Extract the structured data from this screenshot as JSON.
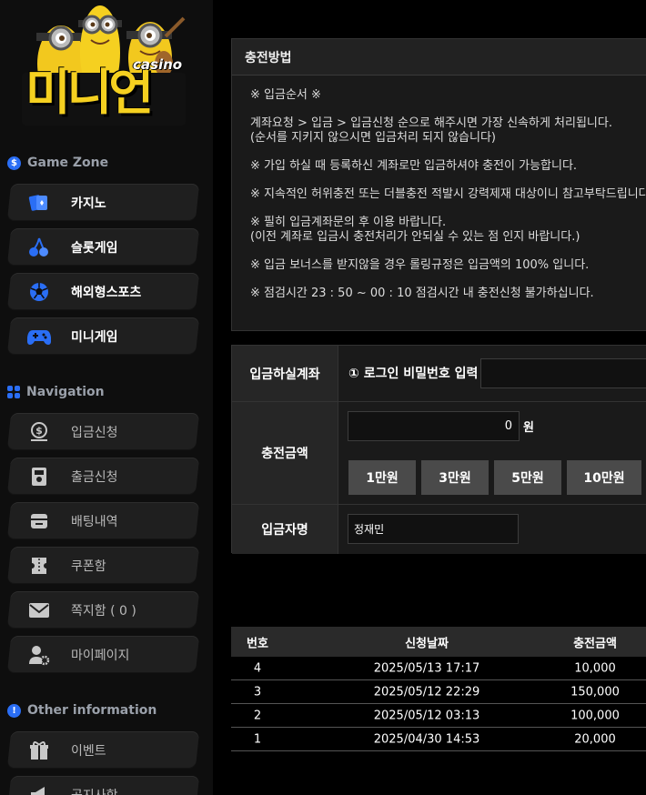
{
  "brand": {
    "name": "미니언",
    "tagline": "casino"
  },
  "sidebar": {
    "game_zone_title": "Game Zone",
    "game_items": [
      {
        "label": "카지노",
        "icon": "cards-icon"
      },
      {
        "label": "슬롯게임",
        "icon": "cherry-icon"
      },
      {
        "label": "해외형스포츠",
        "icon": "soccer-ball-icon"
      },
      {
        "label": "미니게임",
        "icon": "gamepad-icon"
      }
    ],
    "navigation_title": "Navigation",
    "nav_items": [
      {
        "label": "입금신청",
        "icon": "money-bag-icon"
      },
      {
        "label": "출금신청",
        "icon": "atm-icon"
      },
      {
        "label": "배팅내역",
        "icon": "wallet-icon"
      },
      {
        "label": "쿠폰함",
        "icon": "ticket-icon"
      },
      {
        "label": "쪽지함 ( 0 )",
        "icon": "envelope-icon"
      },
      {
        "label": "마이페이지",
        "icon": "user-gear-icon"
      }
    ],
    "other_title": "Other information",
    "other_items": [
      {
        "label": "이벤트",
        "icon": "gift-icon"
      },
      {
        "label": "공지사항",
        "icon": "megaphone-icon"
      }
    ]
  },
  "method": {
    "title": "충전방법",
    "lines": [
      "※ 입금순서 ※",
      "",
      "계좌요청 > 입금 > 입금신청 순으로 해주시면 가장 신속하게 처리됩니다.",
      "(순서를 지키지 않으시면 입금처리 되지 않습니다)",
      "",
      "※ 가입 하실 때 등록하신 계좌로만 입금하셔야 충전이 가능합니다.",
      "",
      "※ 지속적인 허위충전 또는 더블충전 적발시 강력제재 대상이니 참고부탁드립니다.",
      "",
      "※ 필히 입금계좌문의 후 이용 바랍니다.",
      "(이전 계좌로 입금시 충전처리가 안되실 수 있는 점 인지 바랍니다.)",
      "",
      "※ 입금 보너스를 받지않을 경우 롤링규정은 입금액의 100% 입니다.",
      "",
      "※ 점검시간 23 : 50 ~ 00 : 10 점검시간 내 충전신청 불가하십니다."
    ]
  },
  "form": {
    "account_label": "입금하실계좌",
    "password_prompt": "① 로그인 비밀번호 입력",
    "amount_label": "충전금액",
    "amount_value": "0",
    "amount_unit": "원",
    "quick_amounts": [
      "1만원",
      "3만원",
      "5만원",
      "10만원"
    ],
    "depositor_label": "입금자명",
    "depositor_value": "정재민"
  },
  "history": {
    "headers": [
      "번호",
      "신청날짜",
      "충전금액"
    ],
    "rows": [
      {
        "no": "4",
        "date": "2025/05/13 17:17",
        "amount": "10,000"
      },
      {
        "no": "3",
        "date": "2025/05/12 22:29",
        "amount": "150,000"
      },
      {
        "no": "2",
        "date": "2025/05/12 03:13",
        "amount": "100,000"
      },
      {
        "no": "1",
        "date": "2025/04/30 14:53",
        "amount": "20,000"
      }
    ]
  },
  "colors": {
    "accent": "#2a6ef5",
    "logo_yellow": "#f5d020",
    "panel": "#1a1a1a"
  }
}
